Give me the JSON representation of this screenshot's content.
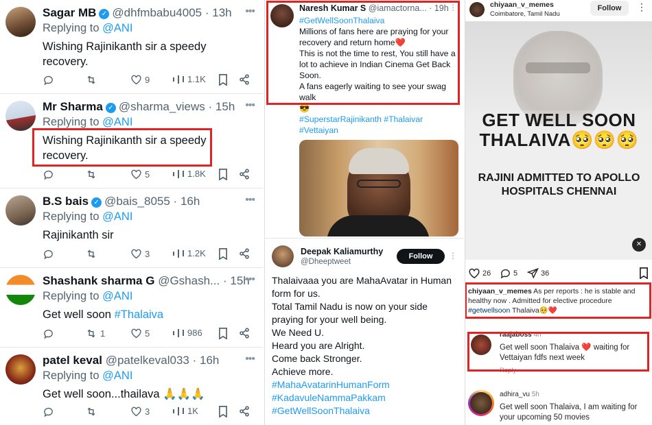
{
  "left_tweets": [
    {
      "name": "Sagar MB",
      "verified": true,
      "handle": "@dhfmbabu4005",
      "time": "13h",
      "reply_label": "Replying to",
      "reply_to": "@ANI",
      "body": "Wishing Rajinikanth sir a speedy recovery.",
      "hashtag": "",
      "likes": "9",
      "views": "1.1K",
      "retweets": ""
    },
    {
      "name": "Mr Sharma",
      "verified": true,
      "handle": "@sharma_views",
      "time": "15h",
      "reply_label": "Replying to",
      "reply_to": "@ANI",
      "body": "Wishing Rajinikanth sir a speedy recovery.",
      "hashtag": "",
      "likes": "5",
      "views": "1.8K",
      "retweets": ""
    },
    {
      "name": "B.S bais",
      "verified": true,
      "handle": "@bais_8055",
      "time": "16h",
      "reply_label": "Replying to",
      "reply_to": "@ANI",
      "body": "Rajinikanth sir",
      "hashtag": "",
      "likes": "3",
      "views": "1.2K",
      "retweets": ""
    },
    {
      "name": "Shashank sharma G",
      "verified": false,
      "handle": "@Gshash...",
      "time": "15h",
      "reply_label": "Replying to",
      "reply_to": "@ANI",
      "body": "Get well soon ",
      "hashtag": "#Thalaiva",
      "likes": "5",
      "views": "986",
      "retweets": "1"
    },
    {
      "name": "patel keval",
      "verified": false,
      "handle": "@patelkeval033",
      "time": "16h",
      "reply_label": "Replying to",
      "reply_to": "@ANI",
      "body": "Get well soon...thailava 🙏🙏🙏",
      "hashtag": "",
      "likes": "3",
      "views": "1K",
      "retweets": ""
    }
  ],
  "middle": {
    "tweet1": {
      "name": "Naresh Kumar S",
      "handle": "@iamactorna...",
      "time": "19h",
      "hashtag_top": "#GetWellSoonThalaiva",
      "lines": [
        "Millions of fans here are praying for your recovery and return home❤️",
        "This is not the time to rest, You still have a lot to achieve in Indian Cinema Get Back Soon.",
        "A fans eagerly waiting to see your swag walk"
      ],
      "emoji": "😎",
      "hashtags_bottom": [
        "#SuperstarRajinikanth #Thalaivar",
        "#Vettaiyan"
      ]
    },
    "tweet2": {
      "name": "Deepak Kaliamurthy",
      "handle": "@Dheeptweet",
      "follow": "Follow",
      "lines": [
        "Thalaivaaa you are MahaAvatar in Human form for us.",
        "Total Tamil Nadu is now on your side praying for your well being.",
        "We Need U.",
        "Heard you are Alright.",
        "Come back Stronger.",
        "Achieve more."
      ],
      "hashtags": [
        "#MahaAvatarinHumanForm",
        "#KadavuleNammaPakkam",
        "#GetWellSoonThalaiva"
      ]
    }
  },
  "right": {
    "user": "chiyaan_v_memes",
    "location": "Coimbatore, Tamil Nadu",
    "follow": "Follow",
    "poster_title": [
      "GET WELL SOON",
      "THALAIVA🥺🥺🥺"
    ],
    "poster_sub": [
      "RAJINI ADMITTED TO APOLLO",
      "HOSPITALS CHENNAI"
    ],
    "likes": "26",
    "comments": "5",
    "shares": "36",
    "caption_user": "chiyaan_v_memes",
    "caption": " As per reports : he is stable and healthy now . Admitted for elective procedure",
    "caption_tag": "#getwellsoon",
    "caption_end": " Thalaiva🥺❤️",
    "comment1_user": "raajaboss",
    "comment1_time": "4h",
    "comment1_text": "Get well soon Thalaiva ❤️ waiting for Vettaiyan fdfs next week",
    "reply": "Reply",
    "comment2_user": "adhira_vu",
    "comment2_time": "5h",
    "comment2_text": "Get well soon Thalaiva, I am waiting for your upcoming 50 movies"
  }
}
